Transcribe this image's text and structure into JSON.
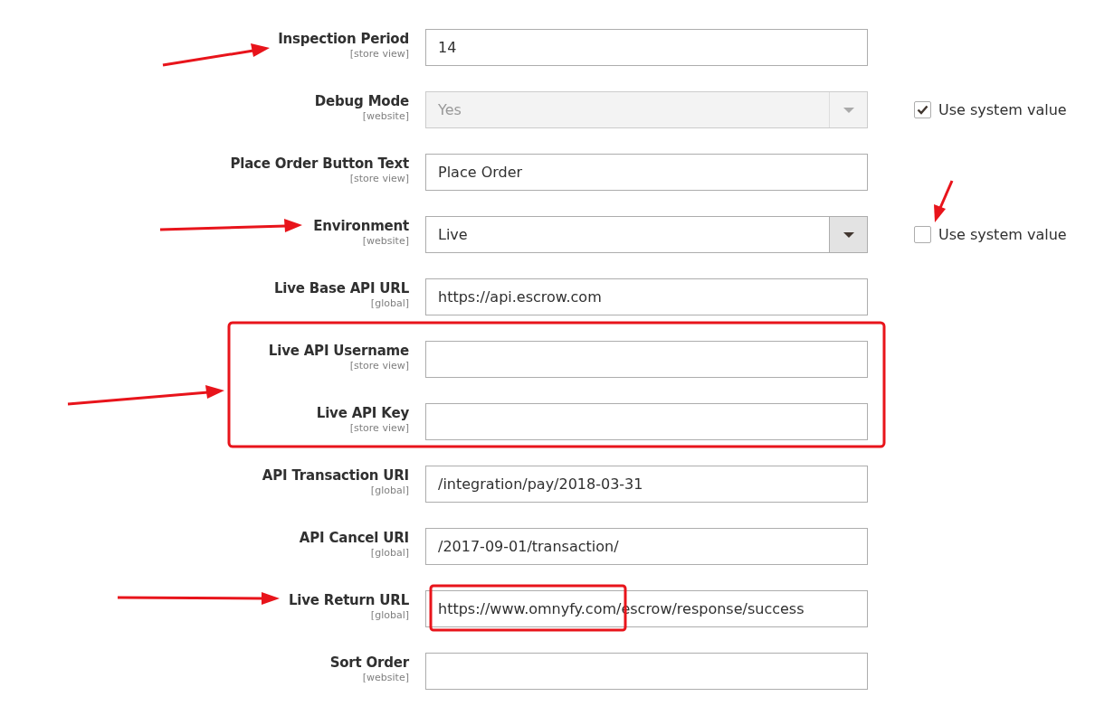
{
  "fields": [
    {
      "label": "Inspection Period",
      "scope": "[store view]",
      "kind": "text",
      "value": "14",
      "disabled": false
    },
    {
      "label": "Debug Mode",
      "scope": "[website]",
      "kind": "select",
      "value": "Yes",
      "disabled": true,
      "use_system_value": {
        "label": "Use system value",
        "checked": true
      }
    },
    {
      "label": "Place Order Button Text",
      "scope": "[store view]",
      "kind": "text",
      "value": "Place Order",
      "disabled": false
    },
    {
      "label": "Environment",
      "scope": "[website]",
      "kind": "select",
      "value": "Live",
      "disabled": false,
      "use_system_value": {
        "label": "Use system value",
        "checked": false
      }
    },
    {
      "label": "Live Base API URL",
      "scope": "[global]",
      "kind": "text",
      "value": "https://api.escrow.com",
      "disabled": false
    },
    {
      "label": "Live API Username",
      "scope": "[store view]",
      "kind": "text",
      "disabled": false
    },
    {
      "label": "Live API Key",
      "scope": "[store view]",
      "kind": "text",
      "disabled": false
    },
    {
      "label": "API Transaction URI",
      "scope": "[global]",
      "kind": "text",
      "value": "/integration/pay/2018-03-31",
      "disabled": false
    },
    {
      "label": "API Cancel URI",
      "scope": "[global]",
      "kind": "text",
      "value": "/2017-09-01/transaction/",
      "disabled": false
    },
    {
      "label": "Live Return URL",
      "scope": "[global]",
      "kind": "text",
      "value": "https://www.omnyfy.com/escrow/response/success",
      "disabled": false
    },
    {
      "label": "Sort Order",
      "scope": "[website]",
      "kind": "text",
      "disabled": false
    }
  ]
}
